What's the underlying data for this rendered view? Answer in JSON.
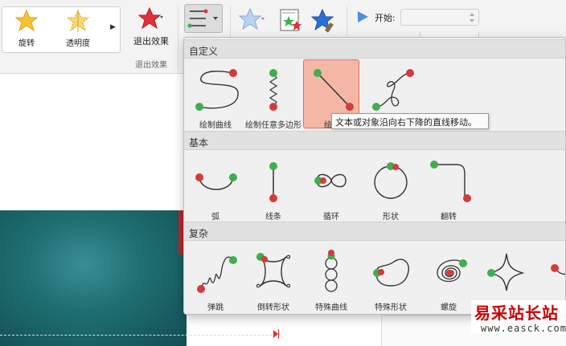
{
  "ribbon": {
    "gallery": [
      {
        "label": "旋转",
        "icon": "star-gold-icon"
      },
      {
        "label": "透明度",
        "icon": "star-gold-translucent-icon"
      }
    ],
    "exit_effect_label": "退出效果",
    "exit_group_label": "退出效果",
    "start_label": "开始:",
    "start_value": ""
  },
  "menu": {
    "sections": [
      {
        "title": "自定义",
        "items": [
          {
            "label": "绘制曲线",
            "icon": "draw-curve-path-icon"
          },
          {
            "label": "绘制任意多边形",
            "icon": "draw-freeform-path-icon"
          },
          {
            "label": "绘制",
            "icon": "draw-line-path-icon",
            "selected": true
          },
          {
            "label": "",
            "icon": "draw-scribble-path-icon"
          }
        ]
      },
      {
        "title": "基本",
        "items": [
          {
            "label": "弧",
            "icon": "arc-path-icon"
          },
          {
            "label": "线条",
            "icon": "line-path-icon"
          },
          {
            "label": "循环",
            "icon": "loop-path-icon"
          },
          {
            "label": "形状",
            "icon": "shape-path-icon"
          },
          {
            "label": "翻转",
            "icon": "turn-path-icon"
          }
        ]
      },
      {
        "title": "复杂",
        "items": [
          {
            "label": "弹跳",
            "icon": "bounce-path-icon"
          },
          {
            "label": "倒转形状",
            "icon": "inverted-shape-path-icon"
          },
          {
            "label": "特殊曲线",
            "icon": "special-curve-path-icon"
          },
          {
            "label": "特殊形状",
            "icon": "special-shape-path-icon"
          },
          {
            "label": "螺旋",
            "icon": "spiral-path-icon"
          },
          {
            "label": "",
            "icon": "star-path-icon"
          },
          {
            "label": "",
            "icon": "partial-path-icon"
          }
        ]
      }
    ],
    "tooltip": "文本或对象沿向右下降的直线移动。"
  },
  "watermark": {
    "text": "易采站长站",
    "url": "www.easck.com"
  },
  "colors": {
    "start_dot": "#3fae4f",
    "end_dot": "#d8393c",
    "selected_bg": "#f4b7a6",
    "selected_border": "#e0735a"
  }
}
